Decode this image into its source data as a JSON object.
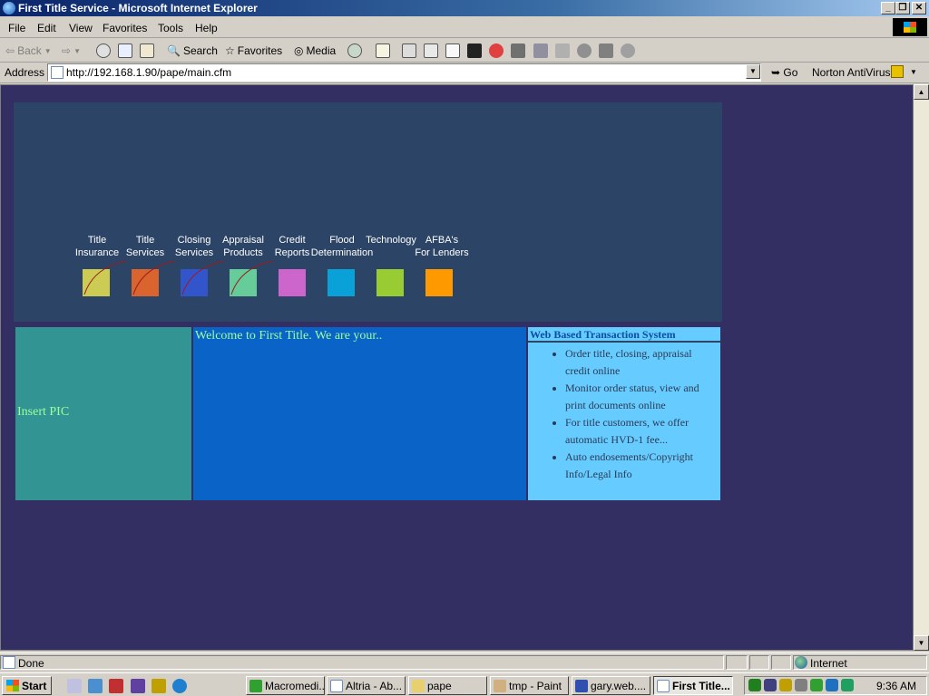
{
  "window": {
    "title": "First Title Service - Microsoft Internet Explorer"
  },
  "menu": [
    "File",
    "Edit",
    "View",
    "Favorites",
    "Tools",
    "Help"
  ],
  "toolbar": {
    "back": "Back",
    "search": "Search",
    "favorites": "Favorites",
    "media": "Media"
  },
  "address": {
    "label": "Address",
    "url": "http://192.168.1.90/pape/main.cfm",
    "go": "Go",
    "norton": "Norton AntiVirus"
  },
  "page": {
    "nav": [
      {
        "line1": "Title",
        "line2": "Insurance",
        "color": "#cccc55"
      },
      {
        "line1": "Title",
        "line2": "Services",
        "color": "#d9642e"
      },
      {
        "line1": "Closing",
        "line2": "Services",
        "color": "#3355cc"
      },
      {
        "line1": "Appraisal",
        "line2": "Products",
        "color": "#66cc99"
      },
      {
        "line1": "Credit",
        "line2": "Reports",
        "color": "#cc66cc"
      },
      {
        "line1": "Flood",
        "line2": "Determination",
        "color": "#0aa0d8"
      },
      {
        "line1": "Technology",
        "line2": "",
        "color": "#99cc33"
      },
      {
        "line1": "AFBA's",
        "line2": "For Lenders",
        "color": "#ff9900"
      }
    ],
    "insert_pic": "Insert PIC",
    "welcome": "Welcome to First Title. We are your..",
    "wbts_title": "Web Based Transaction System",
    "wbts_items": [
      "Order title, closing, appraisal credit online",
      "Monitor order status, view and print documents online",
      "For title customers, we offer automatic HVD-1 fee...",
      "Auto endosements/Copyright Info/Legal Info"
    ],
    "colors": {
      "background": "#332f63",
      "banner": "#2c4466",
      "pic_cell": "#339494",
      "welcome_cell": "#0a63c6",
      "wbts_cell": "#66ccff",
      "green_text": "#9cff9c"
    }
  },
  "status": {
    "text": "Done",
    "zone": "Internet"
  },
  "taskbar": {
    "start": "Start",
    "tasks": [
      "Macromedi...",
      "Altria - Ab...",
      "pape",
      "tmp - Paint",
      "gary.web....",
      "First Title..."
    ],
    "clock": "9:36 AM"
  }
}
